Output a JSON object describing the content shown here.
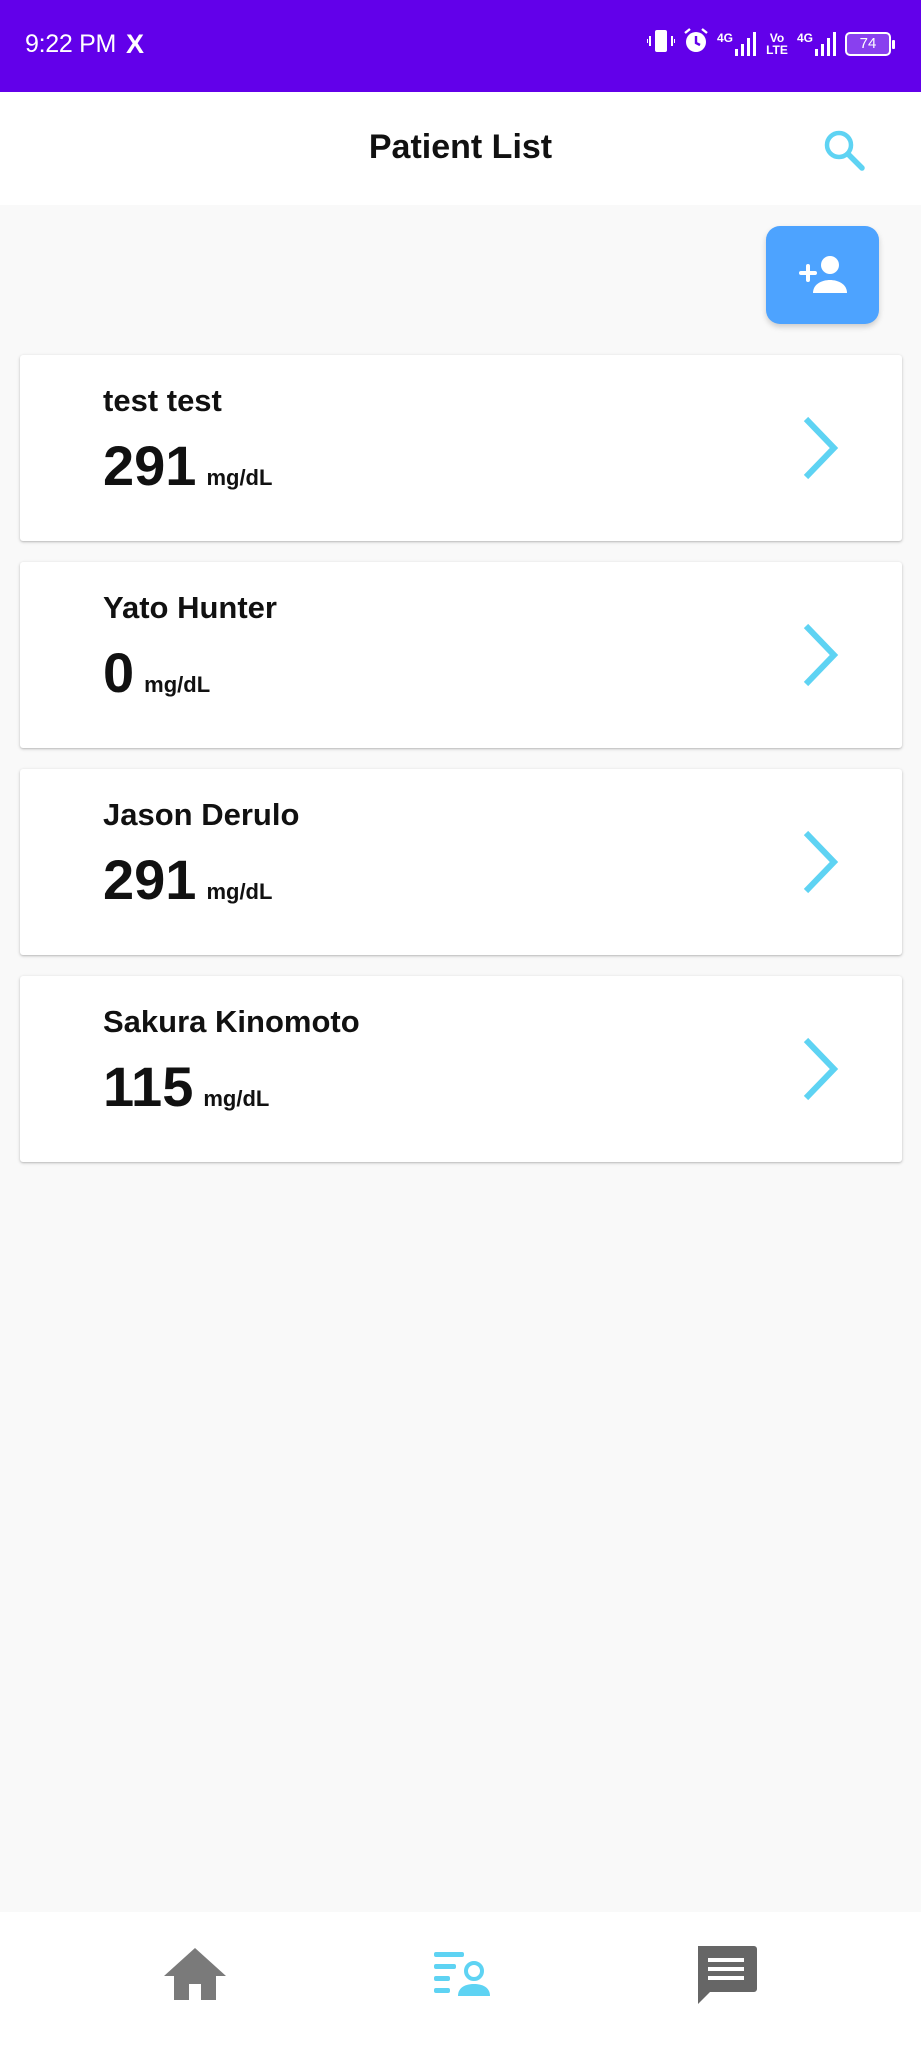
{
  "status_bar": {
    "time": "9:22 PM",
    "app_icon": "X",
    "net1": "4G",
    "volte": "Vo LTE",
    "net2": "4G",
    "battery": "74"
  },
  "header": {
    "title": "Patient List",
    "search_icon": "search-icon"
  },
  "add_patient": {
    "icon": "add-person-icon"
  },
  "patients": [
    {
      "name": "test test",
      "glucose": "291",
      "unit": "mg/dL"
    },
    {
      "name": "Yato Hunter",
      "glucose": "0",
      "unit": "mg/dL"
    },
    {
      "name": "Jason Derulo",
      "glucose": "291",
      "unit": "mg/dL"
    },
    {
      "name": "Sakura Kinomoto",
      "glucose": "115",
      "unit": "mg/dL"
    }
  ],
  "bottom_nav": [
    {
      "icon": "home-icon",
      "active": false
    },
    {
      "icon": "patient-list-icon",
      "active": true
    },
    {
      "icon": "chat-icon",
      "active": false
    }
  ],
  "colors": {
    "status_bar": "#6200ea",
    "accent": "#5ed3f3",
    "add_button": "#4da3ff",
    "nav_inactive": "#7a7a7a",
    "background": "#f9f9f9"
  }
}
